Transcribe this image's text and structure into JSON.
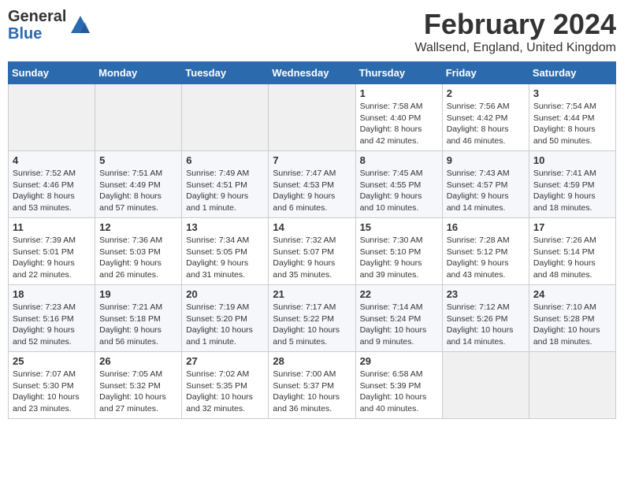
{
  "header": {
    "logo_general": "General",
    "logo_blue": "Blue",
    "main_title": "February 2024",
    "subtitle": "Wallsend, England, United Kingdom"
  },
  "days_of_week": [
    "Sunday",
    "Monday",
    "Tuesday",
    "Wednesday",
    "Thursday",
    "Friday",
    "Saturday"
  ],
  "weeks": [
    [
      {
        "num": "",
        "info": ""
      },
      {
        "num": "",
        "info": ""
      },
      {
        "num": "",
        "info": ""
      },
      {
        "num": "",
        "info": ""
      },
      {
        "num": "1",
        "info": "Sunrise: 7:58 AM\nSunset: 4:40 PM\nDaylight: 8 hours\nand 42 minutes."
      },
      {
        "num": "2",
        "info": "Sunrise: 7:56 AM\nSunset: 4:42 PM\nDaylight: 8 hours\nand 46 minutes."
      },
      {
        "num": "3",
        "info": "Sunrise: 7:54 AM\nSunset: 4:44 PM\nDaylight: 8 hours\nand 50 minutes."
      }
    ],
    [
      {
        "num": "4",
        "info": "Sunrise: 7:52 AM\nSunset: 4:46 PM\nDaylight: 8 hours\nand 53 minutes."
      },
      {
        "num": "5",
        "info": "Sunrise: 7:51 AM\nSunset: 4:49 PM\nDaylight: 8 hours\nand 57 minutes."
      },
      {
        "num": "6",
        "info": "Sunrise: 7:49 AM\nSunset: 4:51 PM\nDaylight: 9 hours\nand 1 minute."
      },
      {
        "num": "7",
        "info": "Sunrise: 7:47 AM\nSunset: 4:53 PM\nDaylight: 9 hours\nand 6 minutes."
      },
      {
        "num": "8",
        "info": "Sunrise: 7:45 AM\nSunset: 4:55 PM\nDaylight: 9 hours\nand 10 minutes."
      },
      {
        "num": "9",
        "info": "Sunrise: 7:43 AM\nSunset: 4:57 PM\nDaylight: 9 hours\nand 14 minutes."
      },
      {
        "num": "10",
        "info": "Sunrise: 7:41 AM\nSunset: 4:59 PM\nDaylight: 9 hours\nand 18 minutes."
      }
    ],
    [
      {
        "num": "11",
        "info": "Sunrise: 7:39 AM\nSunset: 5:01 PM\nDaylight: 9 hours\nand 22 minutes."
      },
      {
        "num": "12",
        "info": "Sunrise: 7:36 AM\nSunset: 5:03 PM\nDaylight: 9 hours\nand 26 minutes."
      },
      {
        "num": "13",
        "info": "Sunrise: 7:34 AM\nSunset: 5:05 PM\nDaylight: 9 hours\nand 31 minutes."
      },
      {
        "num": "14",
        "info": "Sunrise: 7:32 AM\nSunset: 5:07 PM\nDaylight: 9 hours\nand 35 minutes."
      },
      {
        "num": "15",
        "info": "Sunrise: 7:30 AM\nSunset: 5:10 PM\nDaylight: 9 hours\nand 39 minutes."
      },
      {
        "num": "16",
        "info": "Sunrise: 7:28 AM\nSunset: 5:12 PM\nDaylight: 9 hours\nand 43 minutes."
      },
      {
        "num": "17",
        "info": "Sunrise: 7:26 AM\nSunset: 5:14 PM\nDaylight: 9 hours\nand 48 minutes."
      }
    ],
    [
      {
        "num": "18",
        "info": "Sunrise: 7:23 AM\nSunset: 5:16 PM\nDaylight: 9 hours\nand 52 minutes."
      },
      {
        "num": "19",
        "info": "Sunrise: 7:21 AM\nSunset: 5:18 PM\nDaylight: 9 hours\nand 56 minutes."
      },
      {
        "num": "20",
        "info": "Sunrise: 7:19 AM\nSunset: 5:20 PM\nDaylight: 10 hours\nand 1 minute."
      },
      {
        "num": "21",
        "info": "Sunrise: 7:17 AM\nSunset: 5:22 PM\nDaylight: 10 hours\nand 5 minutes."
      },
      {
        "num": "22",
        "info": "Sunrise: 7:14 AM\nSunset: 5:24 PM\nDaylight: 10 hours\nand 9 minutes."
      },
      {
        "num": "23",
        "info": "Sunrise: 7:12 AM\nSunset: 5:26 PM\nDaylight: 10 hours\nand 14 minutes."
      },
      {
        "num": "24",
        "info": "Sunrise: 7:10 AM\nSunset: 5:28 PM\nDaylight: 10 hours\nand 18 minutes."
      }
    ],
    [
      {
        "num": "25",
        "info": "Sunrise: 7:07 AM\nSunset: 5:30 PM\nDaylight: 10 hours\nand 23 minutes."
      },
      {
        "num": "26",
        "info": "Sunrise: 7:05 AM\nSunset: 5:32 PM\nDaylight: 10 hours\nand 27 minutes."
      },
      {
        "num": "27",
        "info": "Sunrise: 7:02 AM\nSunset: 5:35 PM\nDaylight: 10 hours\nand 32 minutes."
      },
      {
        "num": "28",
        "info": "Sunrise: 7:00 AM\nSunset: 5:37 PM\nDaylight: 10 hours\nand 36 minutes."
      },
      {
        "num": "29",
        "info": "Sunrise: 6:58 AM\nSunset: 5:39 PM\nDaylight: 10 hours\nand 40 minutes."
      },
      {
        "num": "",
        "info": ""
      },
      {
        "num": "",
        "info": ""
      }
    ]
  ]
}
